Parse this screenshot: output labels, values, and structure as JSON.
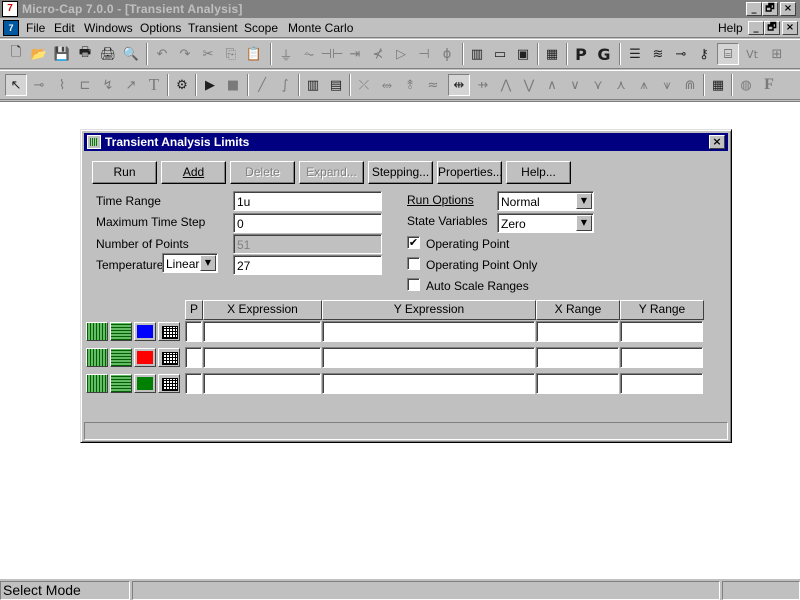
{
  "window": {
    "title": "Micro-Cap 7.0.0 - [Transient Analysis]",
    "app_icon_text": "7",
    "buttons": {
      "minimize": "_",
      "restore": "🗗",
      "close": "×"
    }
  },
  "menubar": {
    "items": [
      "File",
      "Edit",
      "Windows",
      "Options",
      "Transient",
      "Scope",
      "Monte Carlo"
    ],
    "right_item": "Help",
    "doc_buttons": {
      "minimize": "_",
      "restore": "🗗",
      "close": "×"
    }
  },
  "toolbar1": {
    "icons": {
      "new": "🗋",
      "open": "📂",
      "save": "💾",
      "print": "🖶",
      "printer": "🖨",
      "preview": "🔍",
      "undo": "↶",
      "redo": "↷",
      "cut": "✂",
      "copy": "⎘",
      "paste": "📋",
      "ground": "⏚",
      "resistor": "⏦",
      "capacitor": "⊣⊢",
      "diode": "⇥",
      "npn": "⊀",
      "flag": "▷",
      "battery": "⊣",
      "source": "ɸ",
      "window1": "▥",
      "window2": "▭",
      "window3": "▣",
      "calculator": "▦",
      "p_button": "P",
      "g_button": "G",
      "list": "☰",
      "wave": "≋",
      "probe": "⊸",
      "key": "⚷",
      "scope": "⌸",
      "vt": "Vt",
      "panel": "⊞"
    }
  },
  "toolbar2": {
    "icons": {
      "select": "↖",
      "component": "⊸",
      "wire": "⌇",
      "bus": "⊏",
      "wire2": "↯",
      "diag": "↗",
      "text": "T",
      "properties": "⚙",
      "run": "▶",
      "stop": "■",
      "line": "╱",
      "curve": "∫",
      "rows": "▥",
      "rows2": "▤",
      "tool1": "⤫",
      "tool2": "⥈",
      "tool3": "⥉",
      "tool4": "≈",
      "tool5": "⇹",
      "tool6": "⇸",
      "tool7": "⋀",
      "tool8": "⋁",
      "tool9": "∧",
      "tool10": "∨",
      "tool11": "⋎",
      "tool12": "⋏",
      "tool13": "⩚",
      "tool14": "⩛",
      "tool15": "⋒",
      "table": "▦",
      "sphere": "◍",
      "f_button": "F"
    }
  },
  "dialog": {
    "title": "Transient Analysis Limits",
    "close": "×",
    "buttons": {
      "run": "Run",
      "add": "Add",
      "delete": "Delete",
      "expand": "Expand...",
      "stepping": "Stepping...",
      "properties": "Properties...",
      "help": "Help..."
    },
    "fields": {
      "time_range_label": "Time Range",
      "time_range": "1u",
      "max_step_label": "Maximum Time Step",
      "max_step": "0",
      "points_label": "Number of Points",
      "points": "51",
      "temperature_label": "Temperature",
      "temperature_mode": "Linear",
      "temperature": "27"
    },
    "options": {
      "run_options_label": "Run Options",
      "run_options": "Normal",
      "state_variables_label": "State Variables",
      "state_variables": "Zero",
      "operating_point": "Operating Point",
      "operating_point_checked": true,
      "operating_point_only": "Operating Point Only",
      "operating_point_only_checked": false,
      "auto_scale": "Auto Scale Ranges",
      "auto_scale_checked": false,
      "check_mark": "✔"
    },
    "grid": {
      "headers": [
        "P",
        "X Expression",
        "Y Expression",
        "X Range",
        "Y Range"
      ],
      "rows": [
        {
          "color": "#0000ff",
          "p": "",
          "x_expr": "",
          "y_expr": "",
          "x_range": "",
          "y_range": ""
        },
        {
          "color": "#ff0000",
          "p": "",
          "x_expr": "",
          "y_expr": "",
          "x_range": "",
          "y_range": ""
        },
        {
          "color": "#008000",
          "p": "",
          "x_expr": "",
          "y_expr": "",
          "x_range": "",
          "y_range": ""
        }
      ]
    },
    "combo_arrow": "▼"
  },
  "statusbar": {
    "mode": "Select Mode"
  }
}
